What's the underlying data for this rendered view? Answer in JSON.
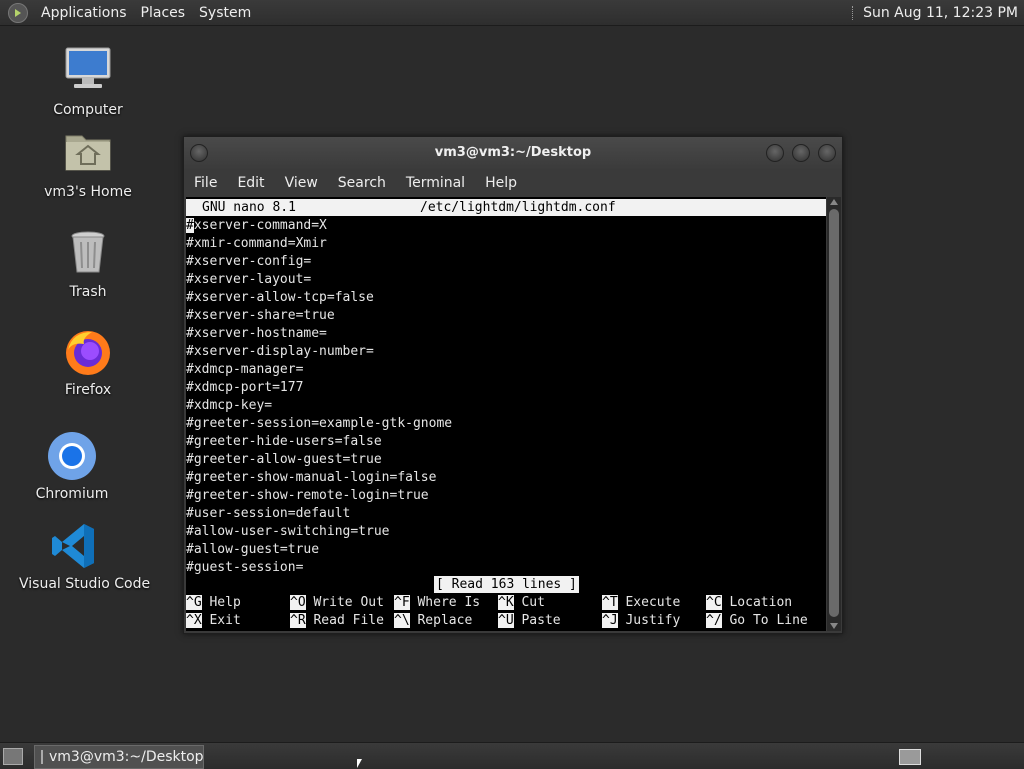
{
  "top_panel": {
    "menus": [
      "Applications",
      "Places",
      "System"
    ],
    "clock": "Sun Aug 11, 12:23 PM"
  },
  "desktop": {
    "icons": [
      {
        "label": "Computer",
        "icon": "computer-icon"
      },
      {
        "label": "vm3's Home",
        "icon": "home-folder-icon"
      },
      {
        "label": "Trash",
        "icon": "trash-icon"
      },
      {
        "label": "Firefox",
        "icon": "firefox-icon"
      },
      {
        "label": "Chromium",
        "icon": "chromium-icon"
      },
      {
        "label": "Visual Studio Code",
        "icon": "vscode-icon"
      }
    ]
  },
  "window": {
    "title": "vm3@vm3:~/Desktop",
    "menus": [
      "File",
      "Edit",
      "View",
      "Search",
      "Terminal",
      "Help"
    ]
  },
  "nano": {
    "version": "GNU nano 8.1",
    "filename": "/etc/lightdm/lightdm.conf",
    "cursor_char": "#",
    "first_line_rest": "xserver-command=X",
    "lines": [
      "#xmir-command=Xmir",
      "#xserver-config=",
      "#xserver-layout=",
      "#xserver-allow-tcp=false",
      "#xserver-share=true",
      "#xserver-hostname=",
      "#xserver-display-number=",
      "#xdmcp-manager=",
      "#xdmcp-port=177",
      "#xdmcp-key=",
      "#greeter-session=example-gtk-gnome",
      "#greeter-hide-users=false",
      "#greeter-allow-guest=true",
      "#greeter-show-manual-login=false",
      "#greeter-show-remote-login=true",
      "#user-session=default",
      "#allow-user-switching=true",
      "#allow-guest=true",
      "#guest-session="
    ],
    "status": "[ Read 163 lines ]",
    "shortcuts": [
      {
        "key": "^G",
        "label": "Help"
      },
      {
        "key": "^O",
        "label": "Write Out"
      },
      {
        "key": "^F",
        "label": "Where Is"
      },
      {
        "key": "^K",
        "label": "Cut"
      },
      {
        "key": "^T",
        "label": "Execute"
      },
      {
        "key": "^C",
        "label": "Location"
      },
      {
        "key": "^X",
        "label": "Exit"
      },
      {
        "key": "^R",
        "label": "Read File"
      },
      {
        "key": "^\\",
        "label": "Replace"
      },
      {
        "key": "^U",
        "label": "Paste"
      },
      {
        "key": "^J",
        "label": "Justify"
      },
      {
        "key": "^/",
        "label": "Go To Line"
      }
    ]
  },
  "taskbar": {
    "task_label": "vm3@vm3:~/Desktop"
  }
}
